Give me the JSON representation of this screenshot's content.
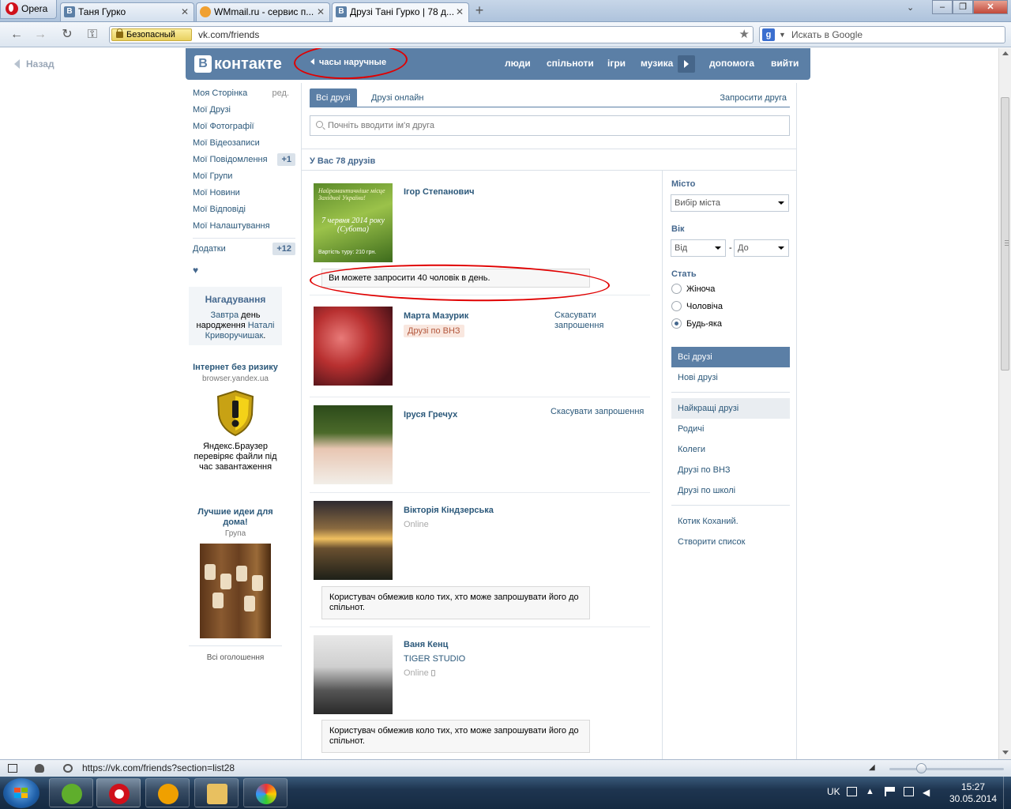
{
  "browser": {
    "menu_label": "Opera",
    "tabs": [
      {
        "title": "Таня Гурко",
        "icon": "vk-icon"
      },
      {
        "title": "WMmail.ru - сервис п...",
        "icon": "wmmail-icon"
      },
      {
        "title": "Друзі Тані Гурко | 78 д...",
        "icon": "vk-icon"
      }
    ],
    "security_label": "Безопасный",
    "url": "vk.com/friends",
    "search_placeholder": "Искать в Google",
    "status_url": "https://vk.com/friends?section=list28"
  },
  "page": {
    "back_label": "Назад",
    "logo_text": "контакте",
    "status_text": "часы наручные",
    "top_nav": [
      "люди",
      "спільноти",
      "ігри",
      "музика",
      "допомога",
      "вийти"
    ],
    "left_menu": [
      {
        "label": "Моя Сторінка",
        "extra": "ред."
      },
      {
        "label": "Мої Друзі"
      },
      {
        "label": "Мої Фотографії"
      },
      {
        "label": "Мої Відеозаписи"
      },
      {
        "label": "Мої Повідомлення",
        "count": "+1"
      },
      {
        "label": "Мої Групи"
      },
      {
        "label": "Мої Новини"
      },
      {
        "label": "Мої Відповіді"
      },
      {
        "label": "Мої Налаштування"
      }
    ],
    "apps": {
      "label": "Додатки",
      "count": "+12"
    },
    "heart": "♥",
    "reminder": {
      "title": "Нагадування",
      "w1": "Завтра",
      "w2": " день народження ",
      "w3": "Наталі Криворучишак",
      "w4": "."
    },
    "ad1": {
      "title": "Інтернет без ризику",
      "domain": "browser.yandex.ua",
      "desc": "Яндекс.Браузер перевіряє файли під час завантаження"
    },
    "ad2": {
      "title": "Лучшие идеи для дома!",
      "sub": "Група"
    },
    "all_ads": "Всі оголошення",
    "tabs": [
      "Всі друзі",
      "Друзі онлайн"
    ],
    "invite_friend": "Запросити друга",
    "search_placeholder": "Почніть вводити ім'я друга",
    "friends_count": "У Вас 78 друзів",
    "invite_limit": "Ви можете запросити 40 чоловік в день.",
    "friends": [
      {
        "name": "Ігор Степанович",
        "photo_text": [
          "Найромантичніше місце",
          "Західної України!",
          "7 червня 2014 року",
          "(Субота)",
          "Вартість туру: 210 грн."
        ]
      },
      {
        "name": "Марта Мазурик",
        "tag": "Друзі по ВНЗ",
        "action": "Скасувати запрошення"
      },
      {
        "name": "Іруся Гречух",
        "action": "Скасувати запрошення"
      },
      {
        "name": "Вікторія Кіндзерська",
        "status": "Online",
        "note": "Користувач обмежив коло тих, хто може запрошувати його до спільнот."
      },
      {
        "name": "Ваня Кенц",
        "sub": "TIGER STUDIO",
        "status": "Online",
        "note": "Користувач обмежив коло тих, хто може запрошувати його до спільнот."
      }
    ],
    "filters": {
      "city_label": "Місто",
      "city_select": "Вибір міста",
      "age_label": "Вік",
      "age_from": "Від",
      "age_dash": "-",
      "age_to": "До",
      "sex_label": "Стать",
      "sex_options": [
        "Жіноча",
        "Чоловіча",
        "Будь-яка"
      ],
      "sex_selected": "Будь-яка",
      "lists": [
        "Всі друзі",
        "Нові друзі",
        "Найкращі друзі",
        "Родичі",
        "Колеги",
        "Друзі по ВНЗ",
        "Друзі по школі",
        "Котик Коханий.",
        "Створити список"
      ]
    }
  },
  "taskbar": {
    "lang": "UK",
    "time": "15:27",
    "date": "30.05.2014"
  },
  "colors": {
    "vk_blue": "#5b7fa6",
    "link": "#2b587a",
    "annotation_red": "#e00000"
  }
}
